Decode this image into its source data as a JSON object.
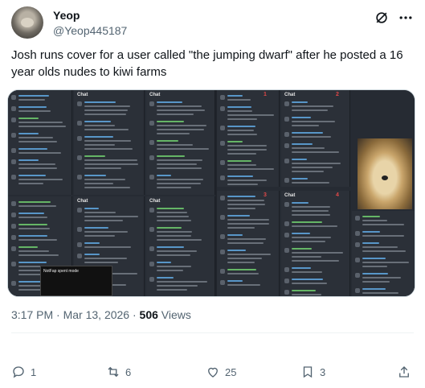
{
  "author": {
    "name": "Yeop",
    "handle": "@Yeop445187"
  },
  "tweet": {
    "text": "Josh runs cover for a user called \"the jumping dwarf\" after he posted a 16 year olds nudes to kiwi farms",
    "time": "3:17 PM",
    "separator": " · ",
    "date": "Mar 13, 2026",
    "views_count": "506",
    "views_label": " Views"
  },
  "media": {
    "chat_label": "Chat",
    "panel_numbers": [
      "1",
      "2",
      "3",
      "4"
    ],
    "screenshot_caption": "NotFap spent mode"
  },
  "actions": {
    "replies": "1",
    "reposts": "6",
    "likes": "25",
    "bookmarks": "3"
  },
  "icons": [
    "avatar",
    "grok-icon",
    "more-icon",
    "reply-icon",
    "repost-icon",
    "like-icon",
    "bookmark-icon",
    "share-icon"
  ],
  "colors": {
    "text": "#0f1419",
    "secondary": "#536471",
    "divider": "#eff3f4",
    "accent_red": "#e04848"
  }
}
